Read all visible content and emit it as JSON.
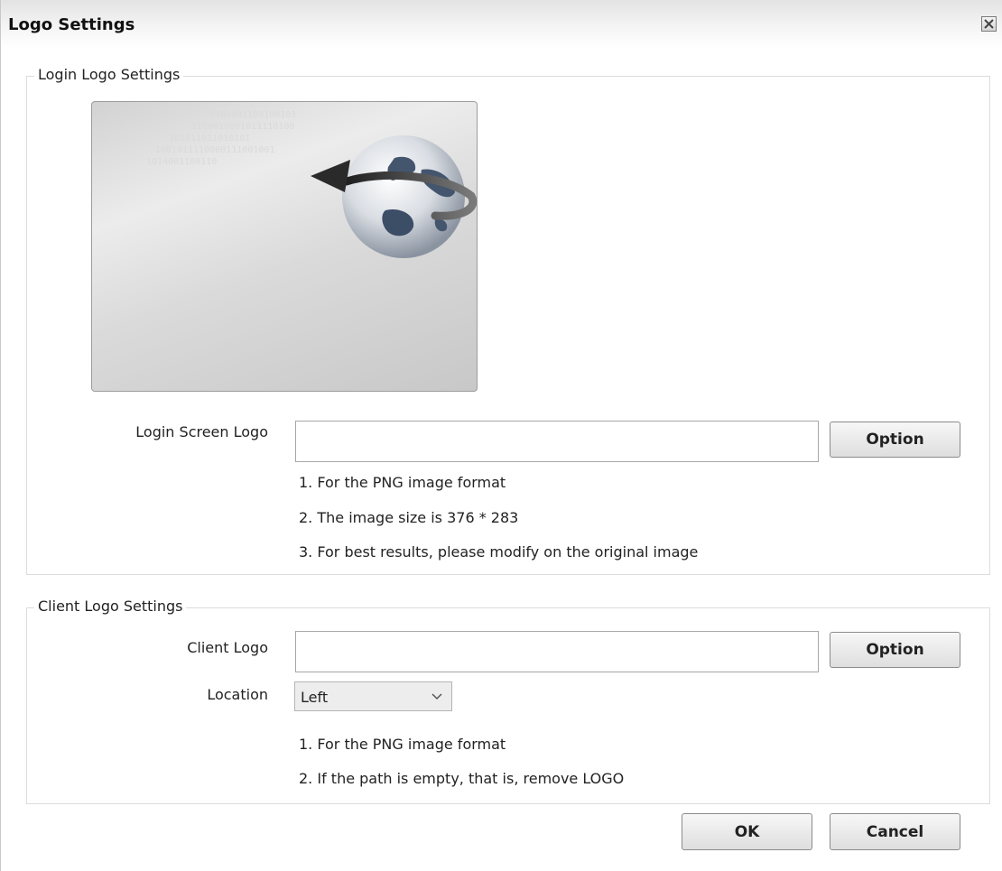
{
  "dialog": {
    "title": "Logo Settings",
    "close_icon": "close-icon"
  },
  "login_group": {
    "legend": "Login Logo Settings",
    "preview_binary": [
      "0101001100100101",
      "1100010001011110100",
      "101011011010101",
      "1001011110000111001001",
      "1014001100110"
    ],
    "field_label": "Login Screen Logo",
    "field_value": "",
    "option_label": "Option",
    "notes": [
      "1. For the PNG image format",
      "2. The image size is 376 * 283",
      "3. For best results, please modify on the original image"
    ]
  },
  "client_group": {
    "legend": "Client Logo Settings",
    "field_label": "Client Logo",
    "field_value": "",
    "option_label": "Option",
    "location_label": "Location",
    "location_value": "Left",
    "notes": [
      "1. For the PNG image format",
      "2. If the path is empty, that is, remove LOGO"
    ]
  },
  "footer": {
    "ok_label": "OK",
    "cancel_label": "Cancel"
  }
}
